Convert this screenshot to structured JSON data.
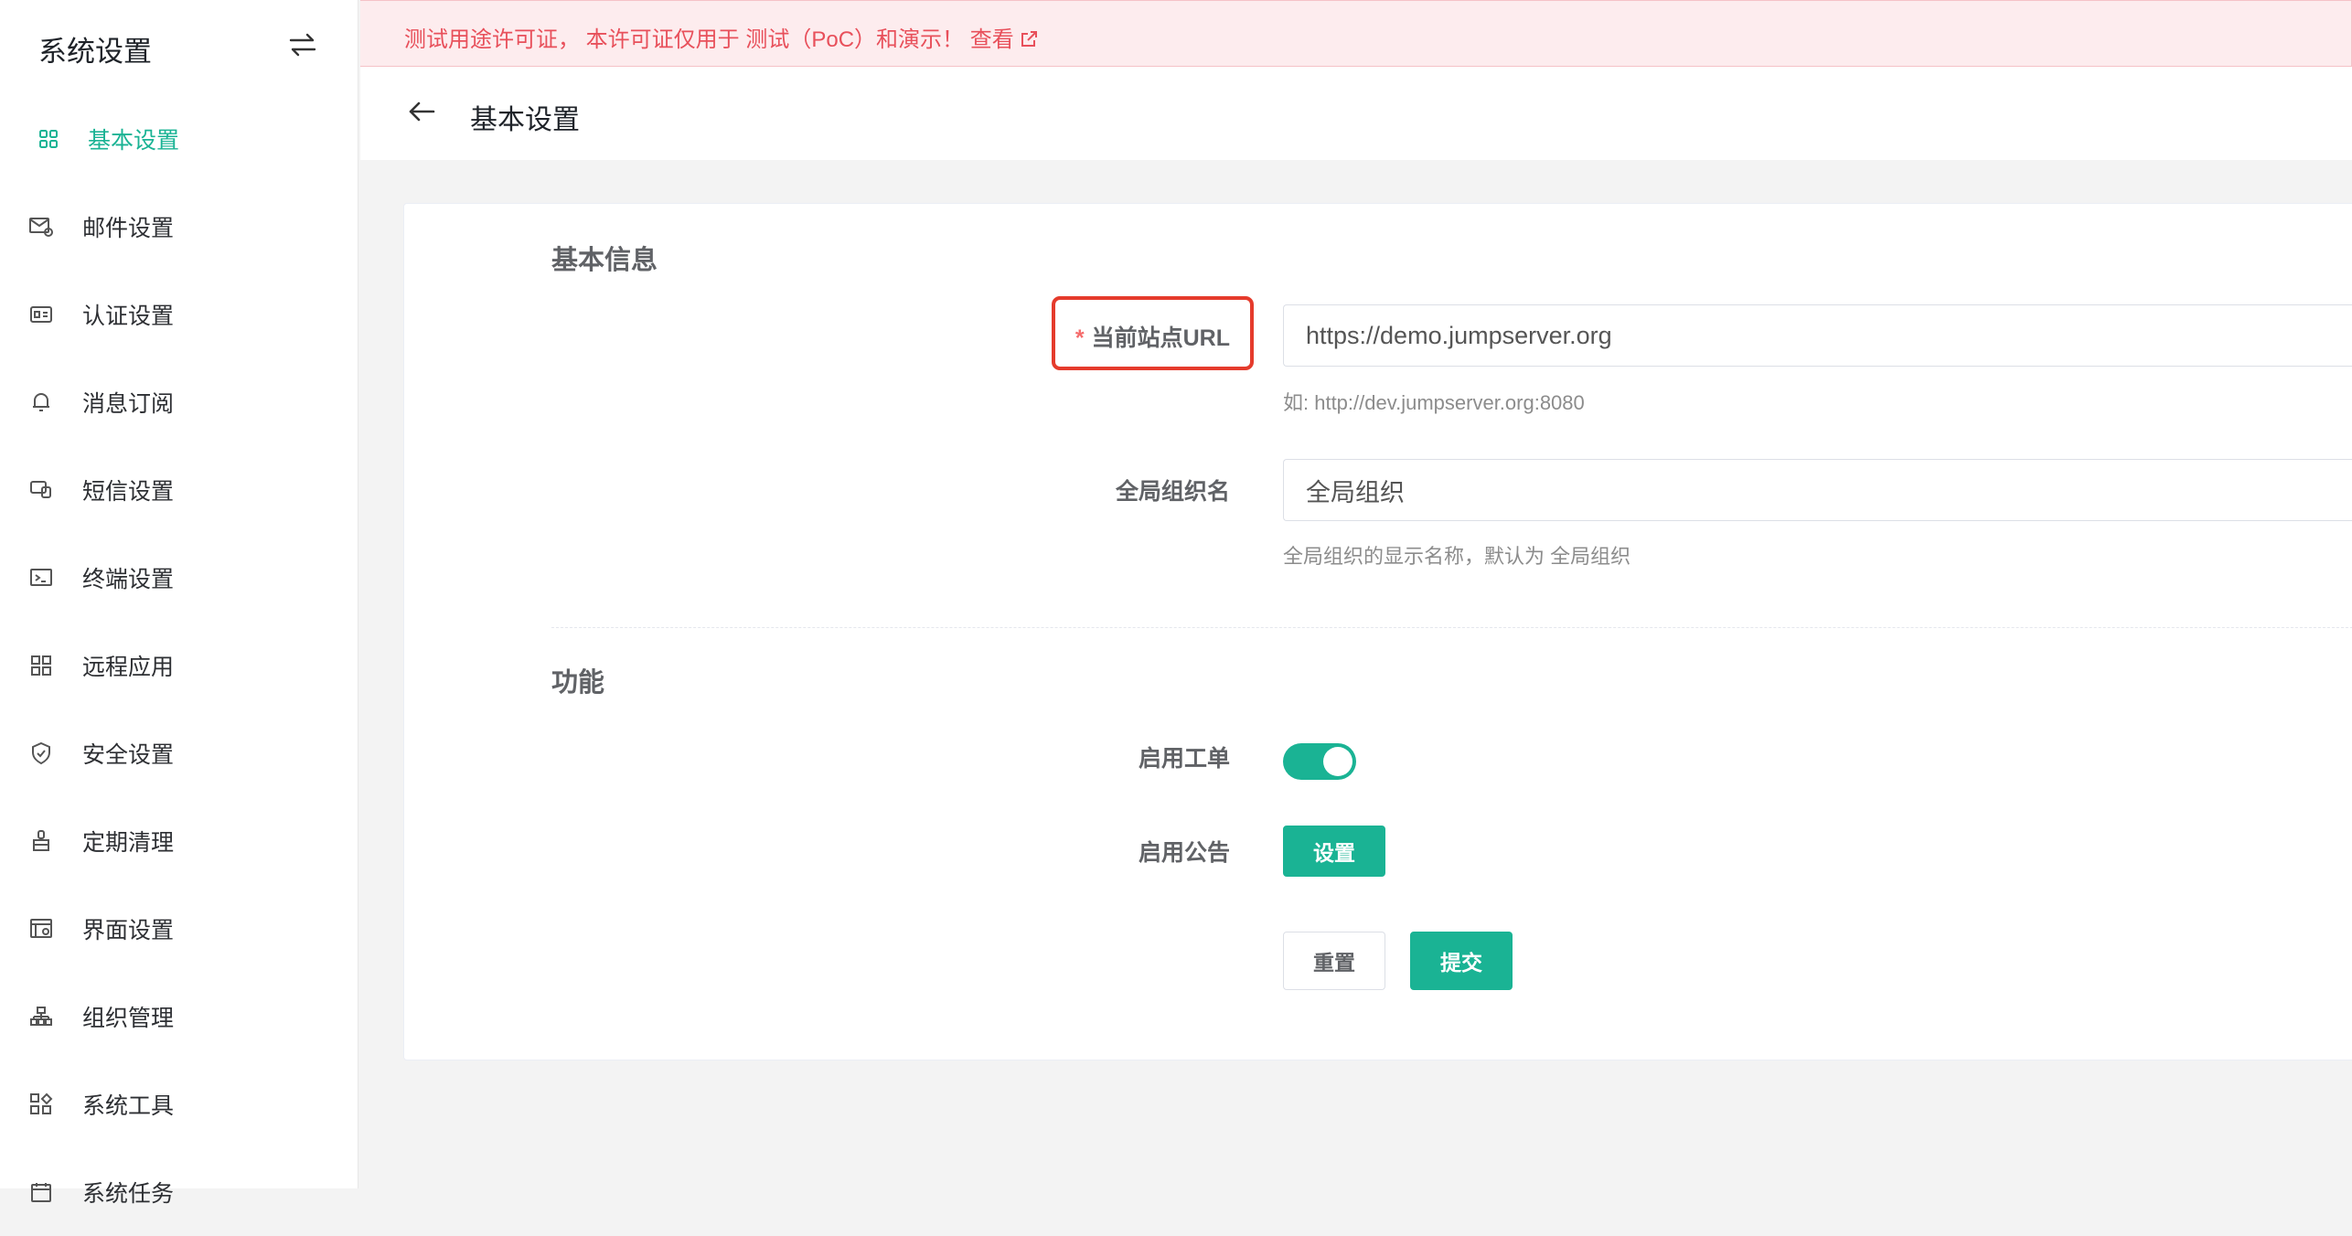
{
  "sidebar": {
    "title": "系统设置",
    "toggle_icon": "swap-arrows-icon",
    "items": [
      {
        "label": "基本设置",
        "icon": "grid-icon",
        "active": true
      },
      {
        "label": "邮件设置",
        "icon": "mail-settings-icon"
      },
      {
        "label": "认证设置",
        "icon": "id-card-icon"
      },
      {
        "label": "消息订阅",
        "icon": "bell-icon"
      },
      {
        "label": "短信设置",
        "icon": "sms-icon"
      },
      {
        "label": "终端设置",
        "icon": "terminal-icon"
      },
      {
        "label": "远程应用",
        "icon": "apps-icon"
      },
      {
        "label": "安全设置",
        "icon": "shield-icon"
      },
      {
        "label": "定期清理",
        "icon": "broom-icon"
      },
      {
        "label": "界面设置",
        "icon": "interface-icon"
      },
      {
        "label": "组织管理",
        "icon": "org-tree-icon"
      },
      {
        "label": "系统工具",
        "icon": "tools-icon"
      },
      {
        "label": "系统任务",
        "icon": "calendar-icon"
      }
    ]
  },
  "banner": {
    "text": "测试用途许可证， 本许可证仅用于 测试（PoC）和演示！",
    "link_label": "查看"
  },
  "header": {
    "title": "基本设置"
  },
  "form": {
    "section_basic": "基本信息",
    "site_url": {
      "required_mark": "*",
      "label": "当前站点URL",
      "value": "https://demo.jumpserver.org",
      "help": "如: http://dev.jumpserver.org:8080"
    },
    "org_name": {
      "label": "全局组织名",
      "value": "全局组织",
      "help": "全局组织的显示名称，默认为 全局组织"
    },
    "section_features": "功能",
    "ticket": {
      "label": "启用工单",
      "enabled": true
    },
    "announcement": {
      "label": "启用公告",
      "button": "设置"
    },
    "reset_label": "重置",
    "submit_label": "提交"
  },
  "colors": {
    "accent": "#1ab394",
    "banner_text": "#e8505b",
    "highlight": "#e53b2c"
  }
}
